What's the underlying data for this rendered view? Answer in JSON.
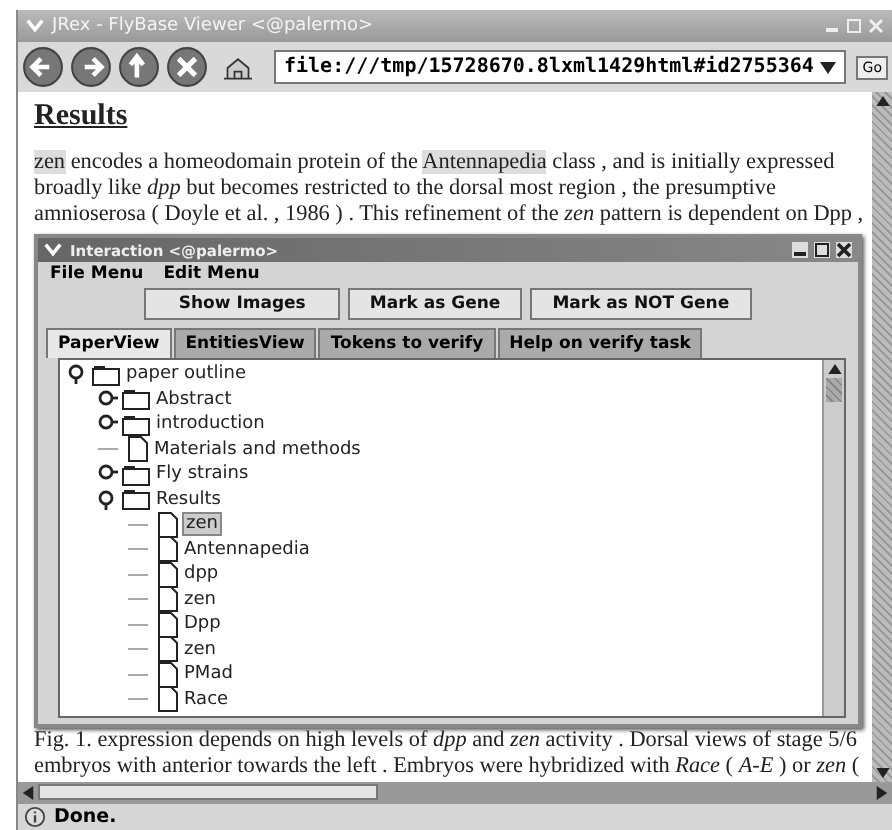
{
  "window": {
    "title": "JRex - FlyBase Viewer <@palermo>"
  },
  "toolbar": {
    "address": "file:///tmp/15728670.8lxml1429html#id2755364",
    "go": "Go"
  },
  "document": {
    "heading": "Results",
    "paragraph": [
      {
        "kind": "highlight",
        "text": "zen"
      },
      {
        "kind": "text",
        "text": " encodes a homeodomain protein of the "
      },
      {
        "kind": "highlight",
        "text": "Antennapedia"
      },
      {
        "kind": "text",
        "text": " class , and is initially expressed broadly like *dpp* but becomes restricted to the dorsal most region , the presumptive amnioserosa ( Doyle et al. , 1986 ) . This refinement of the *zen* pattern is dependent on Dpp ,"
      }
    ],
    "caption": "Fig. 1. expression depends on high levels of *dpp* and *zen* activity . Dorsal views of stage 5/6 embryos with anterior towards the left . Embryos were hybridized with *Race* ( *A-E* ) or *zen* ("
  },
  "dialog": {
    "title": "Interaction <@palermo>",
    "menus": [
      "File Menu",
      "Edit Menu"
    ],
    "buttons": [
      "Show Images",
      "Mark as Gene",
      "Mark as NOT Gene"
    ],
    "tabs": [
      {
        "label": "PaperView",
        "selected": true
      },
      {
        "label": "EntitiesView",
        "selected": false
      },
      {
        "label": "Tokens to verify",
        "selected": false
      },
      {
        "label": "Help on verify task",
        "selected": false
      }
    ],
    "tree": [
      {
        "label": "paper outline",
        "kind": "folder",
        "expanded": true,
        "selected": false,
        "children": [
          {
            "label": "Abstract",
            "kind": "folder",
            "expanded": false,
            "selected": false
          },
          {
            "label": "introduction",
            "kind": "folder",
            "expanded": false,
            "selected": false
          },
          {
            "label": "Materials and methods",
            "kind": "leaf",
            "selected": false
          },
          {
            "label": "Fly strains",
            "kind": "folder",
            "expanded": false,
            "selected": false
          },
          {
            "label": "Results",
            "kind": "folder",
            "expanded": true,
            "selected": false,
            "children": [
              {
                "label": "zen",
                "kind": "leaf",
                "selected": true
              },
              {
                "label": "Antennapedia",
                "kind": "leaf",
                "selected": false
              },
              {
                "label": "dpp",
                "kind": "leaf",
                "selected": false
              },
              {
                "label": "zen",
                "kind": "leaf",
                "selected": false
              },
              {
                "label": "Dpp",
                "kind": "leaf",
                "selected": false
              },
              {
                "label": "zen",
                "kind": "leaf",
                "selected": false
              },
              {
                "label": "PMad",
                "kind": "leaf",
                "selected": false
              },
              {
                "label": "Race",
                "kind": "leaf",
                "selected": false
              }
            ]
          }
        ]
      }
    ]
  },
  "status_bar": {
    "text": "Done."
  }
}
